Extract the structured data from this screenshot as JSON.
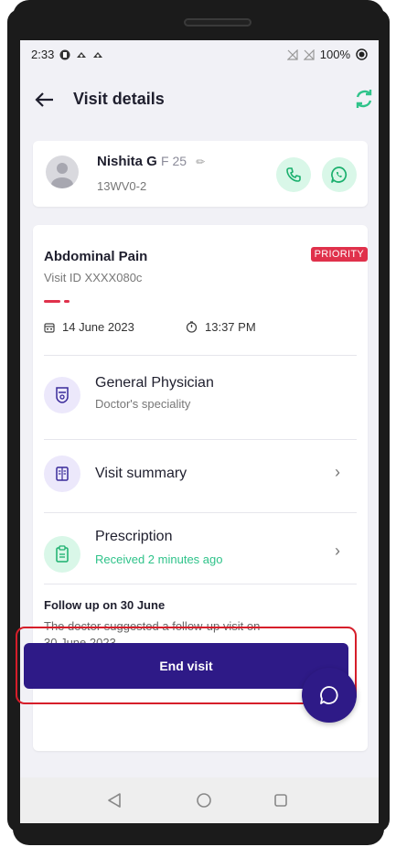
{
  "status_bar": {
    "time": "2:33",
    "battery": "100%"
  },
  "app_bar": {
    "title": "Visit details"
  },
  "patient": {
    "name": "Nishita G",
    "meta": "F 25",
    "id": "13WV0-2"
  },
  "visit": {
    "complaint": "Abdominal Pain",
    "badge": "PRIORITY",
    "visit_id": "Visit ID XXXX080c",
    "date": "14 June 2023",
    "time": "13:37 PM"
  },
  "items": [
    {
      "title": "General Physician",
      "subtitle": "Doctor's speciality"
    },
    {
      "title": "Visit summary"
    },
    {
      "title": "Prescription",
      "subtitle": "Received 2 minutes ago"
    }
  ],
  "follow_up": {
    "title": "Follow up on 30 June",
    "text": "The doctor suggested a follow-up visit on\n 30 June,2023."
  },
  "end_button": {
    "label": "End visit"
  },
  "colors": {
    "primary": "#2e1a87",
    "priority": "#e0314b",
    "success": "#2fc38a",
    "highlight": "#d61e2a"
  },
  "icons": {
    "back": "back-arrow-icon",
    "refresh": "refresh-icon",
    "call": "phone-icon",
    "whatsapp": "whatsapp-icon",
    "calendar": "calendar-icon",
    "clock": "clock-icon",
    "doctor": "doctor-badge-icon",
    "summary": "document-icon",
    "prescription": "clipboard-icon",
    "chat": "chat-icon"
  }
}
